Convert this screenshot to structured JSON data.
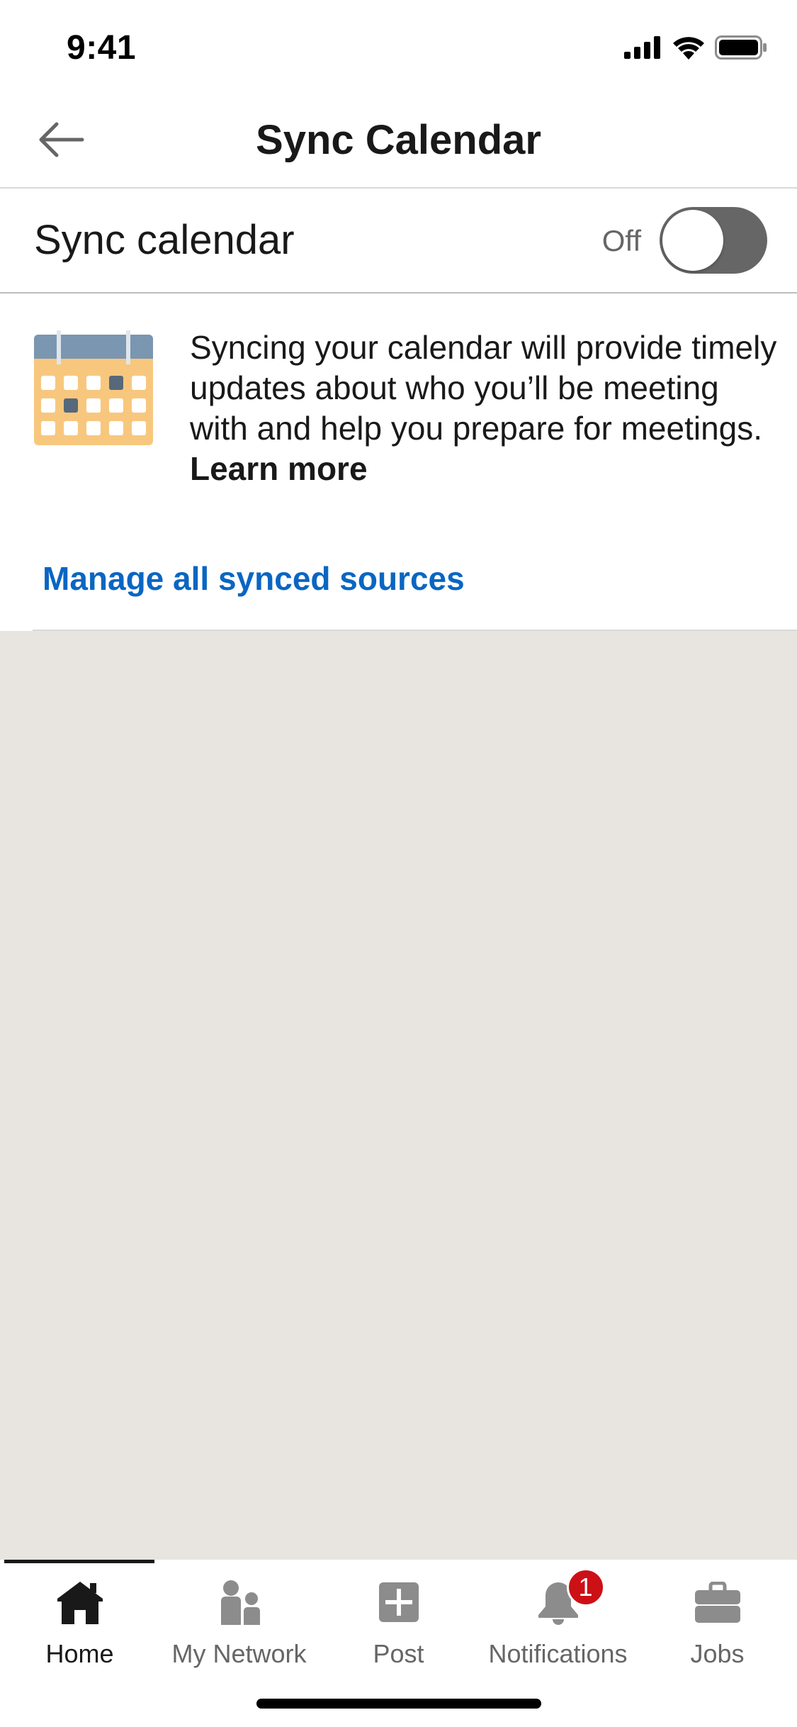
{
  "status_bar": {
    "time": "9:41",
    "icons": [
      "signal-icon",
      "wifi-icon",
      "battery-icon"
    ]
  },
  "header": {
    "title": "Sync Calendar",
    "back_icon": "arrow-left-icon"
  },
  "sync_setting": {
    "label": "Sync calendar",
    "state_text": "Off",
    "enabled": false,
    "toggle_off_color": "#666666"
  },
  "info": {
    "icon": "calendar-icon",
    "description": "Syncing your calendar will provide timely updates about who you’ll be meeting with and help you prepare for meetings.",
    "learn_more": "Learn more",
    "manage_link": "Manage all synced sources",
    "link_color": "#0a66c2"
  },
  "tab_bar": {
    "active_index": 0,
    "items": [
      {
        "label": "Home",
        "icon": "home-icon"
      },
      {
        "label": "My Network",
        "icon": "people-icon"
      },
      {
        "label": "Post",
        "icon": "plus-square-icon"
      },
      {
        "label": "Notifications",
        "icon": "bell-icon",
        "badge": "1"
      },
      {
        "label": "Jobs",
        "icon": "briefcase-icon"
      }
    ]
  },
  "colors": {
    "background_filler": "#e8e4df",
    "badge": "#cc1016",
    "text_primary": "#191919",
    "text_secondary": "#666666"
  }
}
